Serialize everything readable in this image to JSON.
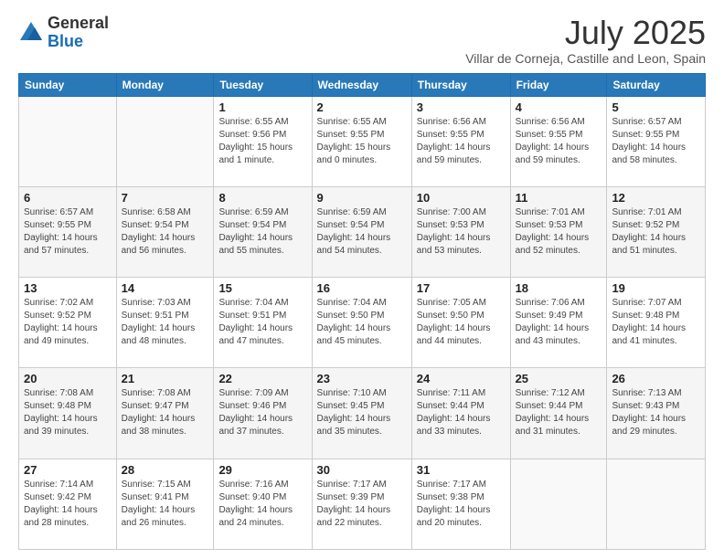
{
  "header": {
    "logo_general": "General",
    "logo_blue": "Blue",
    "main_title": "July 2025",
    "subtitle": "Villar de Corneja, Castille and Leon, Spain"
  },
  "days_of_week": [
    "Sunday",
    "Monday",
    "Tuesday",
    "Wednesday",
    "Thursday",
    "Friday",
    "Saturday"
  ],
  "weeks": [
    [
      {
        "day": "",
        "info": ""
      },
      {
        "day": "",
        "info": ""
      },
      {
        "day": "1",
        "info": "Sunrise: 6:55 AM\nSunset: 9:56 PM\nDaylight: 15 hours and 1 minute."
      },
      {
        "day": "2",
        "info": "Sunrise: 6:55 AM\nSunset: 9:55 PM\nDaylight: 15 hours and 0 minutes."
      },
      {
        "day": "3",
        "info": "Sunrise: 6:56 AM\nSunset: 9:55 PM\nDaylight: 14 hours and 59 minutes."
      },
      {
        "day": "4",
        "info": "Sunrise: 6:56 AM\nSunset: 9:55 PM\nDaylight: 14 hours and 59 minutes."
      },
      {
        "day": "5",
        "info": "Sunrise: 6:57 AM\nSunset: 9:55 PM\nDaylight: 14 hours and 58 minutes."
      }
    ],
    [
      {
        "day": "6",
        "info": "Sunrise: 6:57 AM\nSunset: 9:55 PM\nDaylight: 14 hours and 57 minutes."
      },
      {
        "day": "7",
        "info": "Sunrise: 6:58 AM\nSunset: 9:54 PM\nDaylight: 14 hours and 56 minutes."
      },
      {
        "day": "8",
        "info": "Sunrise: 6:59 AM\nSunset: 9:54 PM\nDaylight: 14 hours and 55 minutes."
      },
      {
        "day": "9",
        "info": "Sunrise: 6:59 AM\nSunset: 9:54 PM\nDaylight: 14 hours and 54 minutes."
      },
      {
        "day": "10",
        "info": "Sunrise: 7:00 AM\nSunset: 9:53 PM\nDaylight: 14 hours and 53 minutes."
      },
      {
        "day": "11",
        "info": "Sunrise: 7:01 AM\nSunset: 9:53 PM\nDaylight: 14 hours and 52 minutes."
      },
      {
        "day": "12",
        "info": "Sunrise: 7:01 AM\nSunset: 9:52 PM\nDaylight: 14 hours and 51 minutes."
      }
    ],
    [
      {
        "day": "13",
        "info": "Sunrise: 7:02 AM\nSunset: 9:52 PM\nDaylight: 14 hours and 49 minutes."
      },
      {
        "day": "14",
        "info": "Sunrise: 7:03 AM\nSunset: 9:51 PM\nDaylight: 14 hours and 48 minutes."
      },
      {
        "day": "15",
        "info": "Sunrise: 7:04 AM\nSunset: 9:51 PM\nDaylight: 14 hours and 47 minutes."
      },
      {
        "day": "16",
        "info": "Sunrise: 7:04 AM\nSunset: 9:50 PM\nDaylight: 14 hours and 45 minutes."
      },
      {
        "day": "17",
        "info": "Sunrise: 7:05 AM\nSunset: 9:50 PM\nDaylight: 14 hours and 44 minutes."
      },
      {
        "day": "18",
        "info": "Sunrise: 7:06 AM\nSunset: 9:49 PM\nDaylight: 14 hours and 43 minutes."
      },
      {
        "day": "19",
        "info": "Sunrise: 7:07 AM\nSunset: 9:48 PM\nDaylight: 14 hours and 41 minutes."
      }
    ],
    [
      {
        "day": "20",
        "info": "Sunrise: 7:08 AM\nSunset: 9:48 PM\nDaylight: 14 hours and 39 minutes."
      },
      {
        "day": "21",
        "info": "Sunrise: 7:08 AM\nSunset: 9:47 PM\nDaylight: 14 hours and 38 minutes."
      },
      {
        "day": "22",
        "info": "Sunrise: 7:09 AM\nSunset: 9:46 PM\nDaylight: 14 hours and 37 minutes."
      },
      {
        "day": "23",
        "info": "Sunrise: 7:10 AM\nSunset: 9:45 PM\nDaylight: 14 hours and 35 minutes."
      },
      {
        "day": "24",
        "info": "Sunrise: 7:11 AM\nSunset: 9:44 PM\nDaylight: 14 hours and 33 minutes."
      },
      {
        "day": "25",
        "info": "Sunrise: 7:12 AM\nSunset: 9:44 PM\nDaylight: 14 hours and 31 minutes."
      },
      {
        "day": "26",
        "info": "Sunrise: 7:13 AM\nSunset: 9:43 PM\nDaylight: 14 hours and 29 minutes."
      }
    ],
    [
      {
        "day": "27",
        "info": "Sunrise: 7:14 AM\nSunset: 9:42 PM\nDaylight: 14 hours and 28 minutes."
      },
      {
        "day": "28",
        "info": "Sunrise: 7:15 AM\nSunset: 9:41 PM\nDaylight: 14 hours and 26 minutes."
      },
      {
        "day": "29",
        "info": "Sunrise: 7:16 AM\nSunset: 9:40 PM\nDaylight: 14 hours and 24 minutes."
      },
      {
        "day": "30",
        "info": "Sunrise: 7:17 AM\nSunset: 9:39 PM\nDaylight: 14 hours and 22 minutes."
      },
      {
        "day": "31",
        "info": "Sunrise: 7:17 AM\nSunset: 9:38 PM\nDaylight: 14 hours and 20 minutes."
      },
      {
        "day": "",
        "info": ""
      },
      {
        "day": "",
        "info": ""
      }
    ]
  ]
}
